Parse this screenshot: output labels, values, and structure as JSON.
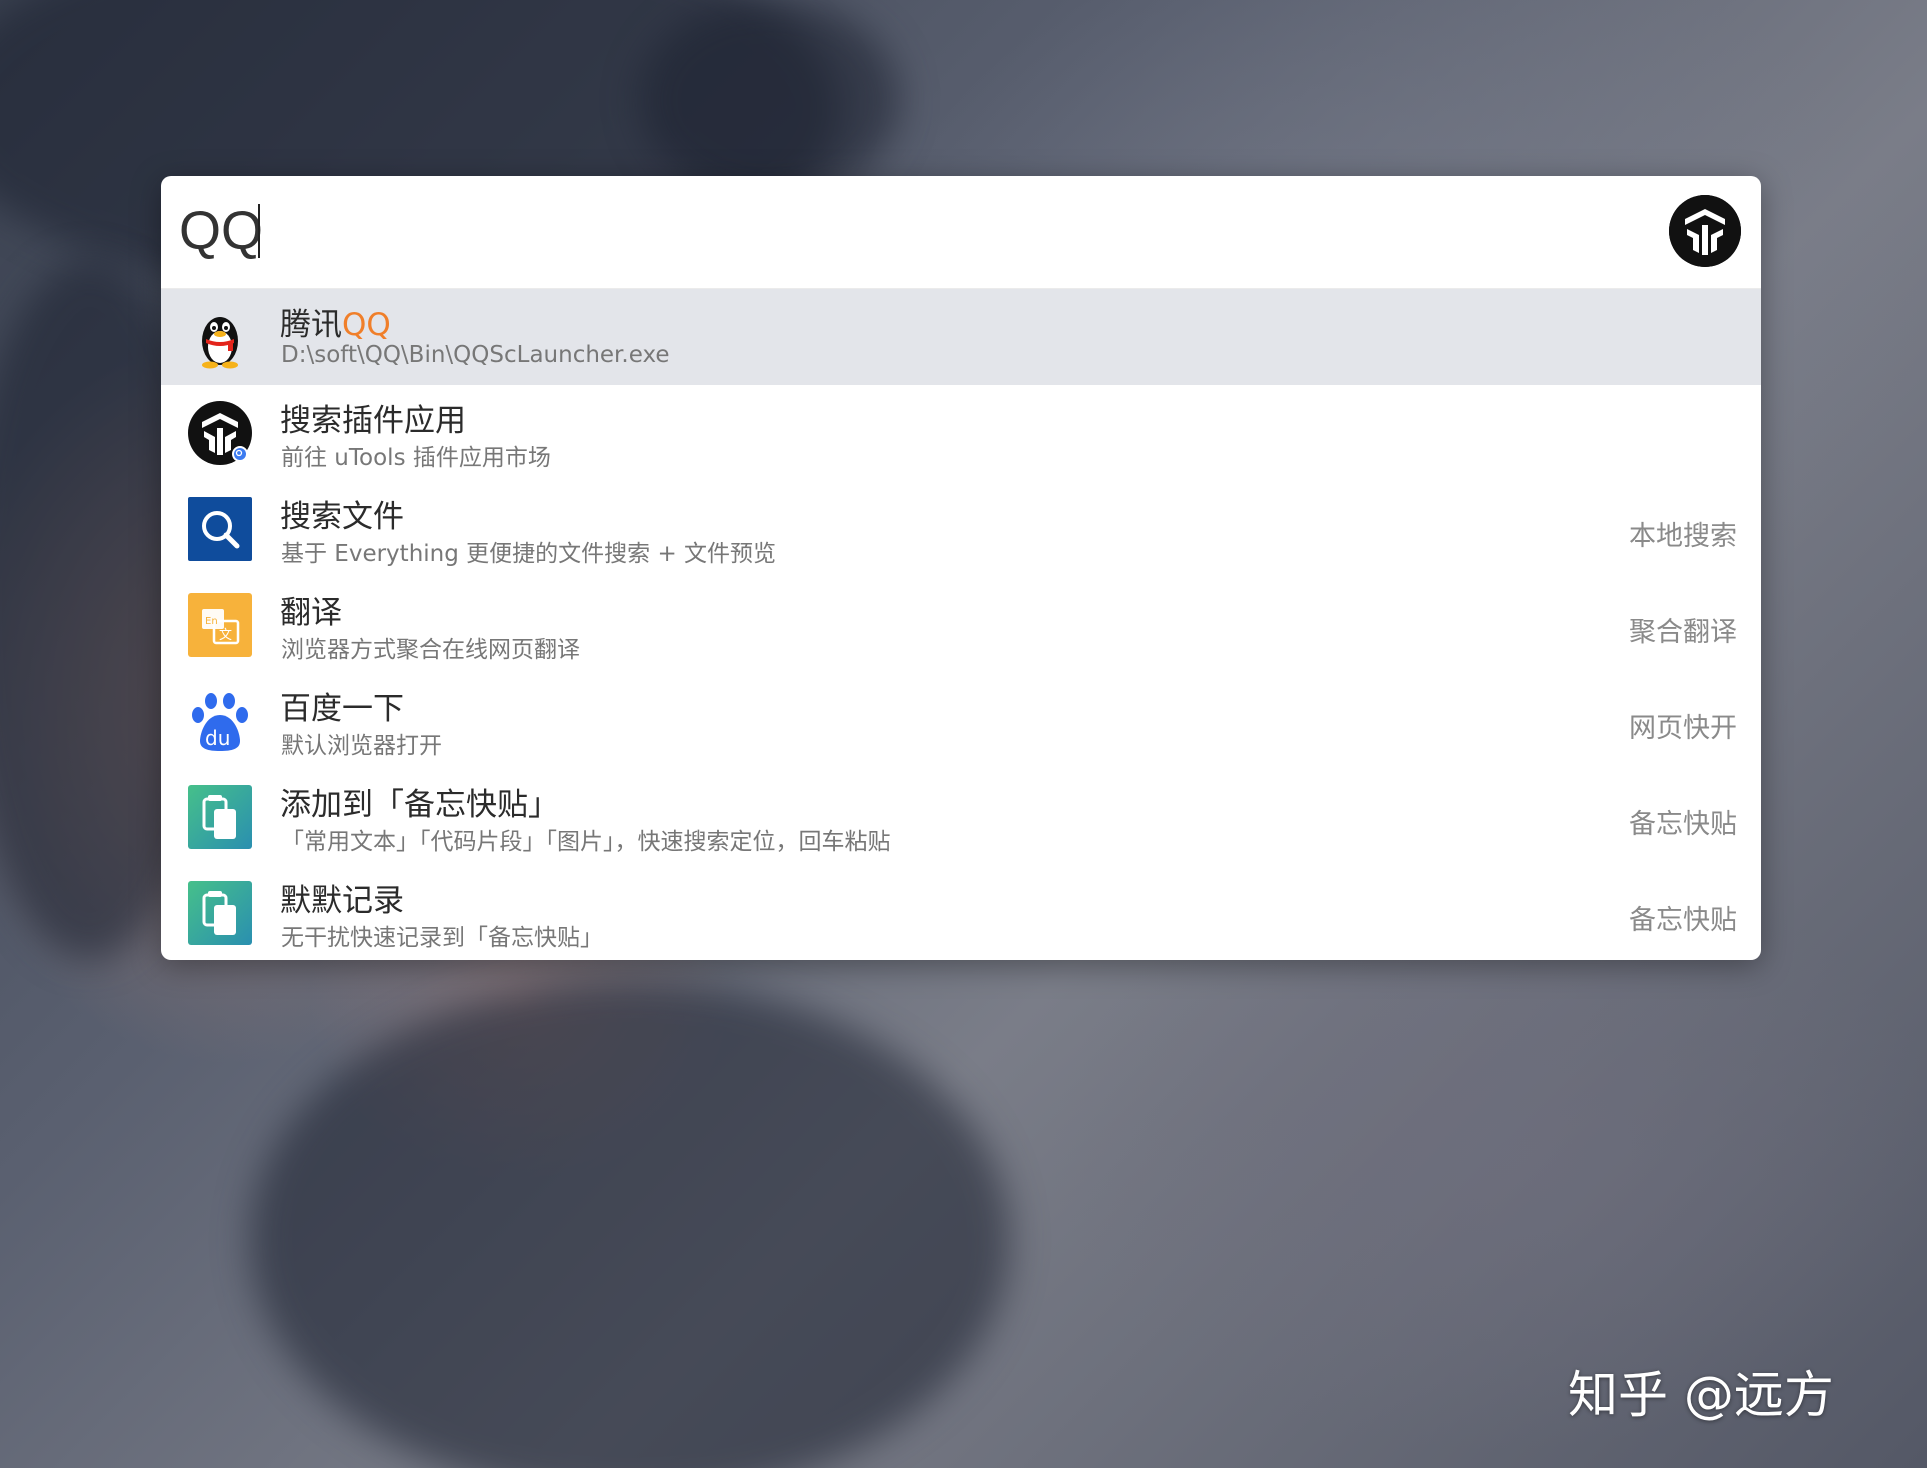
{
  "search": {
    "value": "QQ"
  },
  "results": [
    {
      "title_prefix": "腾讯",
      "title_highlight": "QQ",
      "subtitle": "D:\\soft\\QQ\\Bin\\QQScLauncher.exe",
      "tag": "",
      "icon": "qq-penguin-icon"
    },
    {
      "title": "搜索插件应用",
      "subtitle": "前往 uTools 插件应用市场",
      "tag": "",
      "icon": "utools-logo-icon"
    },
    {
      "title": "搜索文件",
      "subtitle": "基于 Everything 更便捷的文件搜索 + 文件预览",
      "tag": "本地搜索",
      "icon": "file-search-icon"
    },
    {
      "title": "翻译",
      "subtitle": "浏览器方式聚合在线网页翻译",
      "tag": "聚合翻译",
      "icon": "translate-icon"
    },
    {
      "title": "百度一下",
      "subtitle": "默认浏览器打开",
      "tag": "网页快开",
      "icon": "baidu-paw-icon"
    },
    {
      "title": "添加到「备忘快贴」",
      "subtitle": "「常用文本」「代码片段」「图片」，快速搜索定位，回车粘贴",
      "tag": "备忘快贴",
      "icon": "clipboard-icon"
    },
    {
      "title": "默默记录",
      "subtitle": "无干扰快速记录到「备忘快贴」",
      "tag": "备忘快贴",
      "icon": "clipboard-icon"
    }
  ],
  "watermark": "知乎 @远方",
  "colors": {
    "highlight": "#f07f2a",
    "selected_row": "#e3e5ea",
    "file_search_tile": "#0f4c9c",
    "translate_tile": "#f7b23b",
    "baidu_blue": "#2f6bed",
    "clipboard_teal": "#2fa79a"
  }
}
